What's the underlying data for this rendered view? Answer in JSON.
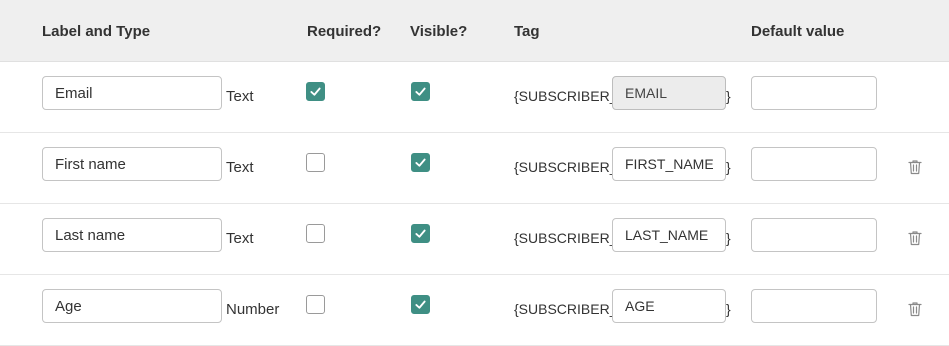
{
  "header": {
    "label_and_type": "Label and Type",
    "required": "Required?",
    "visible": "Visible?",
    "tag": "Tag",
    "default_value": "Default value"
  },
  "rows": [
    {
      "label": "Email",
      "type": "Text",
      "required": true,
      "visible": true,
      "tag_prefix": "{SUBSCRIBER_",
      "tag": "EMAIL",
      "tag_suffix": "}",
      "tag_editable": false,
      "default_value": "",
      "deletable": false
    },
    {
      "label": "First name",
      "type": "Text",
      "required": false,
      "visible": true,
      "tag_prefix": "{SUBSCRIBER_",
      "tag": "FIRST_NAME",
      "tag_suffix": "}",
      "tag_editable": true,
      "default_value": "",
      "deletable": true
    },
    {
      "label": "Last name",
      "type": "Text",
      "required": false,
      "visible": true,
      "tag_prefix": "{SUBSCRIBER_",
      "tag": "LAST_NAME",
      "tag_suffix": "}",
      "tag_editable": true,
      "default_value": "",
      "deletable": true
    },
    {
      "label": "Age",
      "type": "Number",
      "required": false,
      "visible": true,
      "tag_prefix": "{SUBSCRIBER_",
      "tag": "AGE",
      "tag_suffix": "}",
      "tag_editable": true,
      "default_value": "",
      "deletable": true
    }
  ],
  "icons": {
    "check": "check-icon",
    "delete": "trash-icon"
  },
  "colors": {
    "checkbox_checked": "#3f8f84",
    "header_bg": "#efefef"
  }
}
